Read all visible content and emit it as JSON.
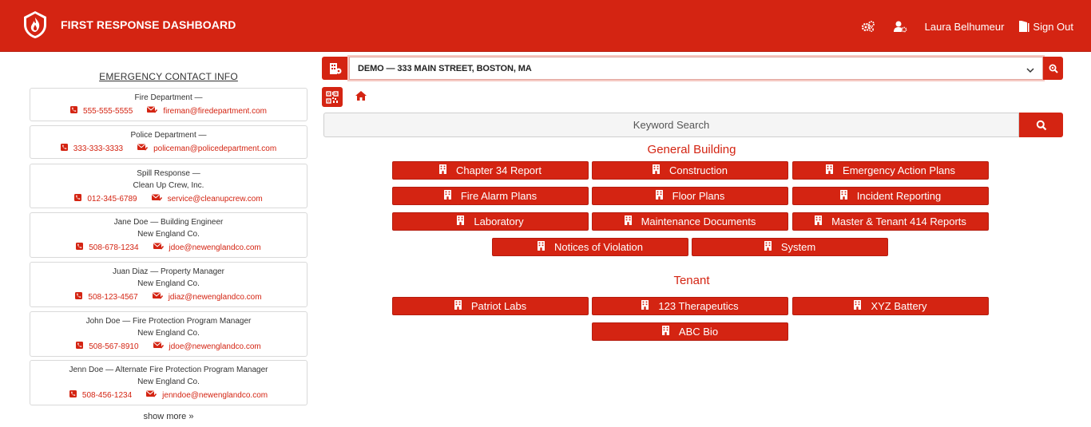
{
  "header": {
    "title": "FIRST RESPONSE DASHBOARD",
    "user_name": "Laura Belhumeur",
    "sign_out_label": "Sign Out",
    "accent_color": "#d42412"
  },
  "contacts": {
    "title": "EMERGENCY CONTACT INFO",
    "show_more": "show more »",
    "cards": [
      {
        "lines": [
          "Fire Department —"
        ],
        "phone": "555-555-5555",
        "email": "fireman@firedepartment.com"
      },
      {
        "lines": [
          "Police Department —"
        ],
        "phone": "333-333-3333",
        "email": "policeman@policedepartment.com"
      },
      {
        "lines": [
          "Spill Response —",
          "Clean Up Crew, Inc."
        ],
        "phone": "012-345-6789",
        "email": "service@cleanupcrew.com"
      },
      {
        "lines": [
          "Jane Doe — Building Engineer",
          "New England Co."
        ],
        "phone": "508-678-1234",
        "email": "jdoe@newenglandco.com"
      },
      {
        "lines": [
          "Juan Diaz — Property Manager",
          "New England Co."
        ],
        "phone": "508-123-4567",
        "email": "jdiaz@newenglandco.com"
      },
      {
        "lines": [
          "John Doe — Fire Protection Program Manager",
          "New England Co."
        ],
        "phone": "508-567-8910",
        "email": "jdoe@newenglandco.com"
      },
      {
        "lines": [
          "Jenn Doe — Alternate Fire Protection Program Manager",
          "New England Co."
        ],
        "phone": "508-456-1234",
        "email": "jenndoe@newenglandco.com"
      }
    ]
  },
  "location": {
    "selected": "DEMO — 333 MAIN STREET, BOSTON, MA"
  },
  "search": {
    "placeholder": "Keyword Search"
  },
  "general_building": {
    "title": "General Building",
    "buttons": [
      "Chapter 34 Report",
      "Construction",
      "Emergency Action Plans",
      "Fire Alarm Plans",
      "Floor Plans",
      "Incident Reporting",
      "Laboratory",
      "Maintenance Documents",
      "Master & Tenant 414 Reports",
      "Notices of Violation",
      "System"
    ]
  },
  "tenant": {
    "title": "Tenant",
    "buttons": [
      "Patriot Labs",
      "123 Therapeutics",
      "XYZ Battery",
      "ABC Bio"
    ]
  }
}
